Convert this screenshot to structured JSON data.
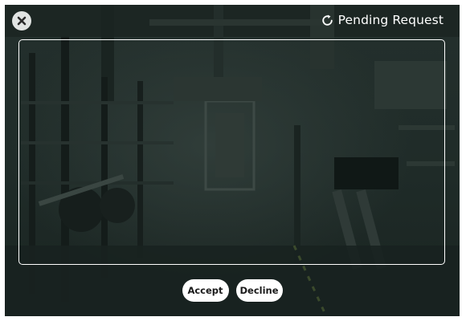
{
  "header": {
    "status_label": "Pending Request",
    "status_icon": "refresh-icon",
    "close_icon": "close-icon"
  },
  "actions": {
    "accept_label": "Accept",
    "decline_label": "Decline"
  },
  "colors": {
    "overlay": "#1d2a27",
    "frame": "#ffffff",
    "button_bg": "#ffffff",
    "button_text": "#1a1a1a",
    "close_bg": "#e1e4e3"
  }
}
